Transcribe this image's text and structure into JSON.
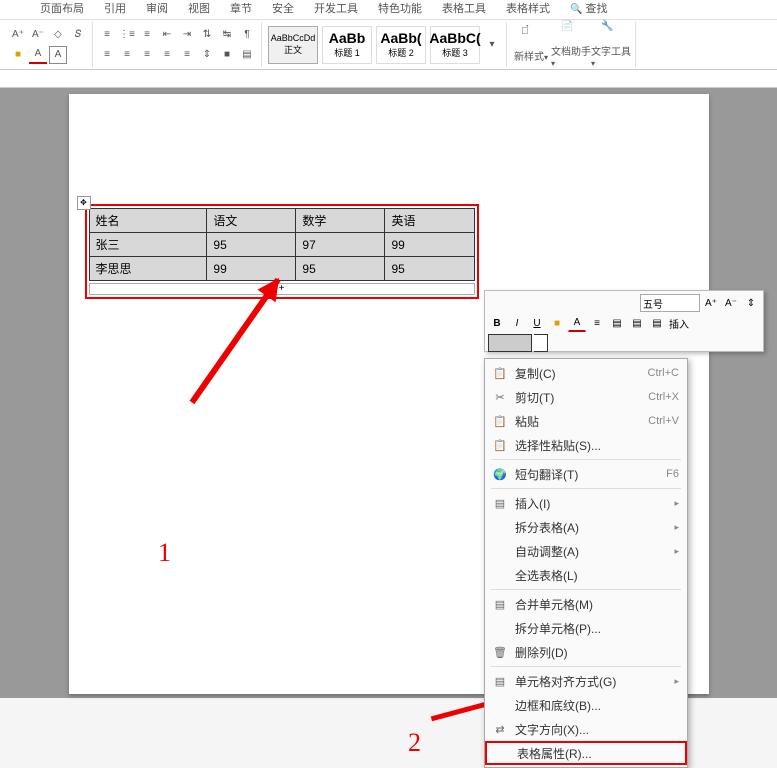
{
  "menuTabs": [
    "页面布局",
    "引用",
    "审阅",
    "视图",
    "章节",
    "安全",
    "开发工具",
    "特色功能",
    "表格工具",
    "表格样式",
    "查找"
  ],
  "styles": [
    {
      "preview": "AaBbCcDd",
      "name": "正文",
      "active": true
    },
    {
      "preview": "AaBb",
      "name": "标题 1",
      "active": false
    },
    {
      "preview": "AaBb(",
      "name": "标题 2",
      "active": false
    },
    {
      "preview": "AaBbC(",
      "name": "标题 3",
      "active": false
    }
  ],
  "ribbon_large": [
    {
      "name": "新样式"
    },
    {
      "name": "文档助手"
    },
    {
      "name": "文字工具"
    }
  ],
  "table": {
    "rows": [
      [
        "姓名",
        "语文",
        "数学",
        "英语"
      ],
      [
        "张三",
        "95",
        "97",
        "99"
      ],
      [
        "李思思",
        "99",
        "95",
        "95"
      ]
    ]
  },
  "mini": {
    "font_size_label": "五号",
    "insert_label": "插入"
  },
  "annotations": {
    "one": "1",
    "two": "2"
  },
  "context_menu": [
    {
      "icon": "copy",
      "text": "复制(C)",
      "shortcut": "Ctrl+C",
      "type": "item"
    },
    {
      "icon": "cut",
      "text": "剪切(T)",
      "shortcut": "Ctrl+X",
      "type": "item"
    },
    {
      "icon": "paste",
      "text": "粘贴",
      "shortcut": "Ctrl+V",
      "type": "item"
    },
    {
      "icon": "paste-special",
      "text": "选择性粘贴(S)...",
      "type": "item"
    },
    {
      "type": "sep"
    },
    {
      "icon": "translate",
      "text": "短句翻译(T)",
      "shortcut": "F6",
      "type": "item"
    },
    {
      "type": "sep"
    },
    {
      "icon": "insert",
      "text": "插入(I)",
      "sub": true,
      "type": "item"
    },
    {
      "text": "拆分表格(A)",
      "sub": true,
      "type": "item"
    },
    {
      "text": "自动调整(A)",
      "sub": true,
      "type": "item"
    },
    {
      "text": "全选表格(L)",
      "type": "item"
    },
    {
      "type": "sep"
    },
    {
      "icon": "merge",
      "text": "合并单元格(M)",
      "type": "item"
    },
    {
      "text": "拆分单元格(P)...",
      "type": "item"
    },
    {
      "icon": "delete",
      "text": "删除列(D)",
      "type": "item"
    },
    {
      "type": "sep"
    },
    {
      "icon": "align",
      "text": "单元格对齐方式(G)",
      "sub": true,
      "type": "item"
    },
    {
      "text": "边框和底纹(B)...",
      "type": "item"
    },
    {
      "icon": "textdir",
      "text": "文字方向(X)...",
      "type": "item"
    },
    {
      "text": "表格属性(R)...",
      "type": "item",
      "highlight": true
    }
  ]
}
